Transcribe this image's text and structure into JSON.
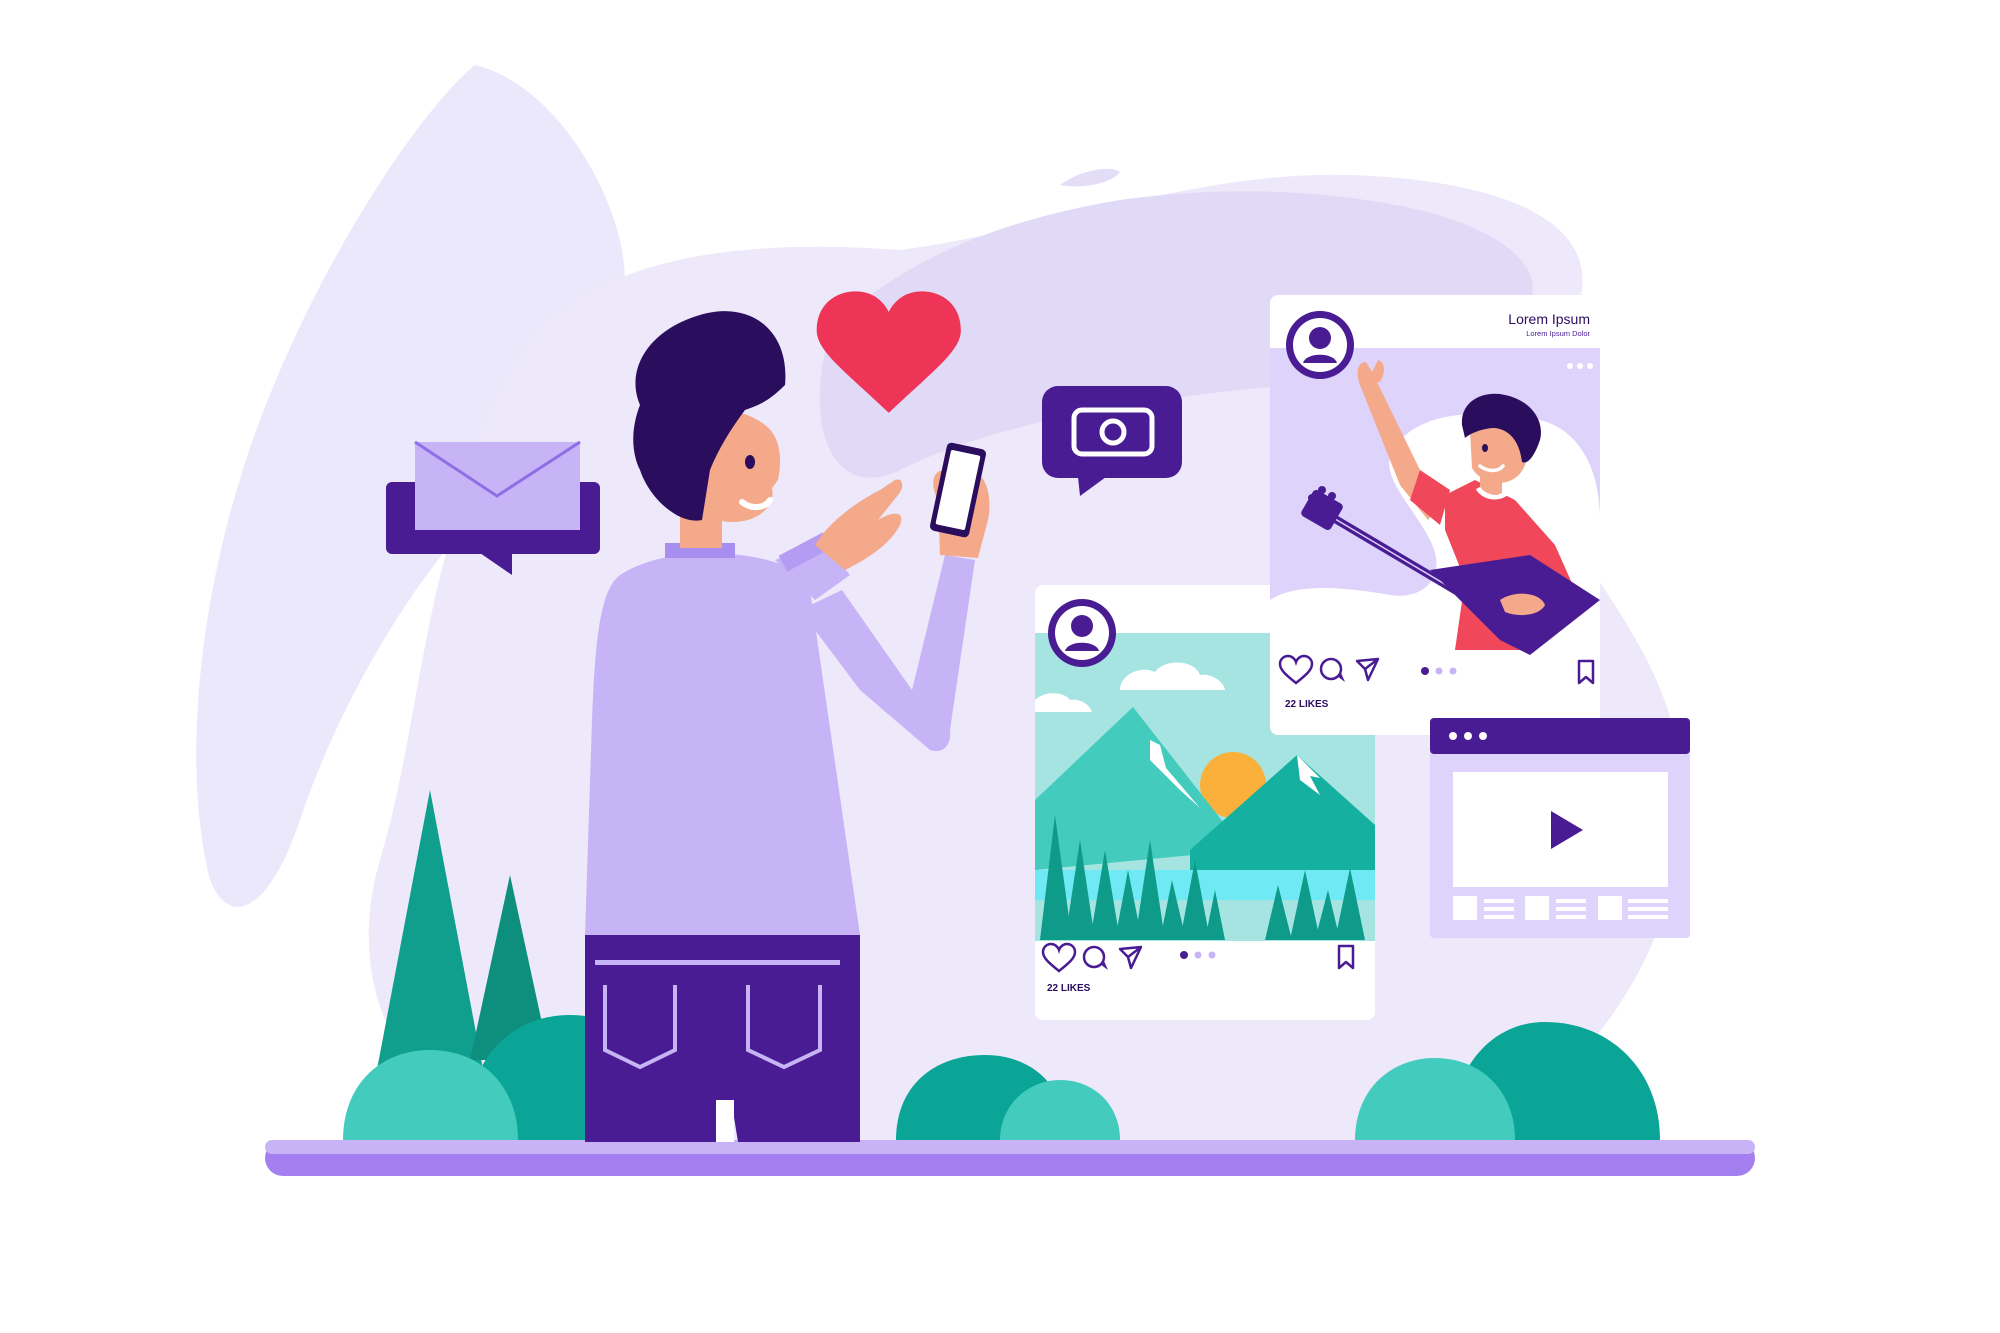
{
  "colors": {
    "background": "#ffffff",
    "blob_light": "#ede9fb",
    "blob_mid": "#e0daf7",
    "card": "#ffffff",
    "lavender": "#c6b4f6",
    "lavender_light": "#ddd3fb",
    "purple_dark": "#4a1c94",
    "purple_deep": "#2b0d5e",
    "heart_red": "#ee3557",
    "shirt_red": "#f0485a",
    "skin": "#f4a98a",
    "teal_dark": "#0e9b8a",
    "teal": "#15b0a0",
    "teal_light": "#43cbbd",
    "sky": "#a6e4e2",
    "lake": "#6fe9f4",
    "sun": "#fbb03b",
    "ground": "#a47ff0"
  },
  "icons": [
    "envelope-icon",
    "heart-icon",
    "camera-icon",
    "avatar-icon",
    "like-icon",
    "comment-icon",
    "share-icon",
    "bookmark-icon",
    "play-icon",
    "more-dots-icon"
  ],
  "post_musician": {
    "name": "Lorem Ipsum",
    "subtitle": "Lorem Ipsum Dolor",
    "likes": "22 LIKES"
  },
  "post_landscape": {
    "likes": "22 LIKES"
  },
  "video_window": {
    "dots": 3
  }
}
